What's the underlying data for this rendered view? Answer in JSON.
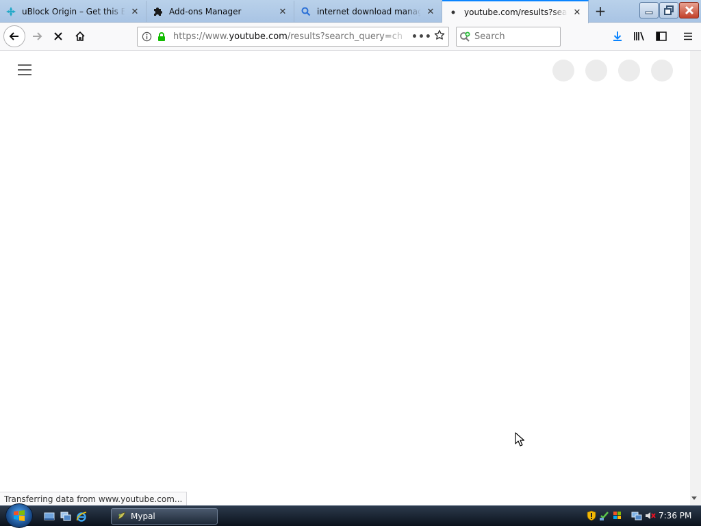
{
  "tabs": [
    {
      "title": "uBlock Origin – Get this Extension for Firefox",
      "icon": "ublock-icon",
      "active": false
    },
    {
      "title": "Add-ons Manager",
      "icon": "puzzle-icon",
      "active": false
    },
    {
      "title": "internet download manager on YouTube",
      "icon": "search-icon",
      "active": false
    },
    {
      "title": "youtube.com/results?search_query=",
      "icon": "loading-dot-icon",
      "active": true
    }
  ],
  "tab_close_glyph": "✕",
  "new_tab_glyph": "+",
  "url": {
    "prefix": "https://www.",
    "host": "youtube.com",
    "path": "/results?search_query=ch"
  },
  "url_more_glyph": "•••",
  "search": {
    "placeholder": "Search"
  },
  "status_text": "Transferring data from www.youtube.com...",
  "taskbar": {
    "task_label": "Mypal",
    "clock": "7:36 PM"
  },
  "colors": {
    "accent": "#0a84ff",
    "lock_green": "#12bc00",
    "download_blue": "#0a84ff"
  }
}
